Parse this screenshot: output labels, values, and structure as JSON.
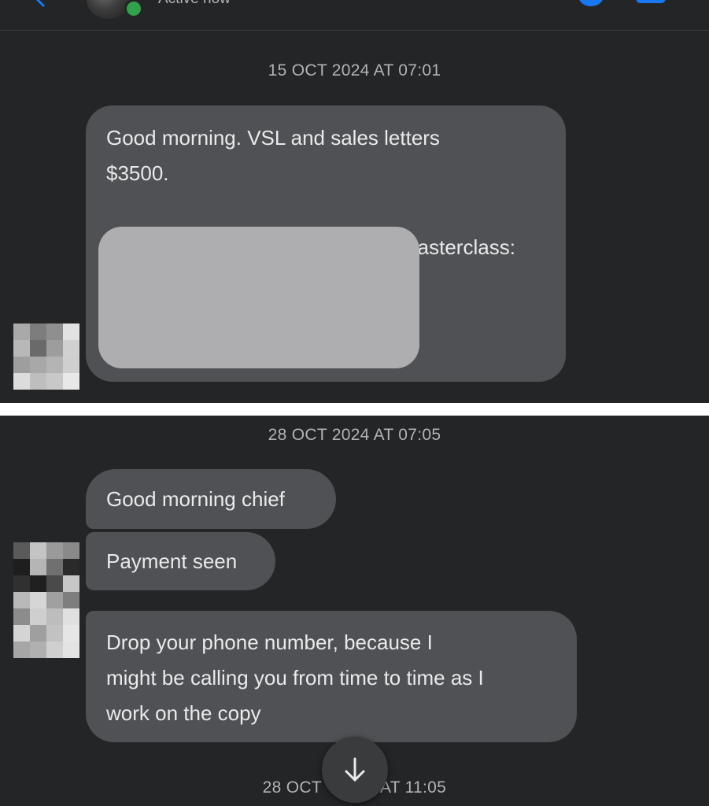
{
  "header": {
    "status": "Active now",
    "icons": [
      "back-arrow-icon",
      "avatar",
      "online-indicator",
      "phone-icon",
      "video-icon"
    ]
  },
  "top_section": {
    "timestamp": "15 OCT 2024 AT 07:01",
    "message": {
      "lines": [
        "Good morning.  VSL and sales letters",
        "$3500."
      ],
      "partial_text": "Masterclass:"
    }
  },
  "bottom_section": {
    "timestamp": "28 OCT 2024 AT 07:05",
    "messages": [
      {
        "lines": [
          "Good morning chief"
        ]
      },
      {
        "lines": [
          "Payment seen"
        ]
      },
      {
        "lines": [
          "Drop your phone number,  because  I",
          "might be calling you from time to time as I",
          "work on the copy"
        ]
      }
    ],
    "next_timestamp_left": "28 OCT",
    "next_timestamp_right": "AT 11:05"
  },
  "colors": {
    "background": "#242526",
    "bubble": "#505154",
    "text": "#e9eaec",
    "timestamp": "#b0b3b8",
    "accent": "#1877f2",
    "online": "#31a24c"
  }
}
